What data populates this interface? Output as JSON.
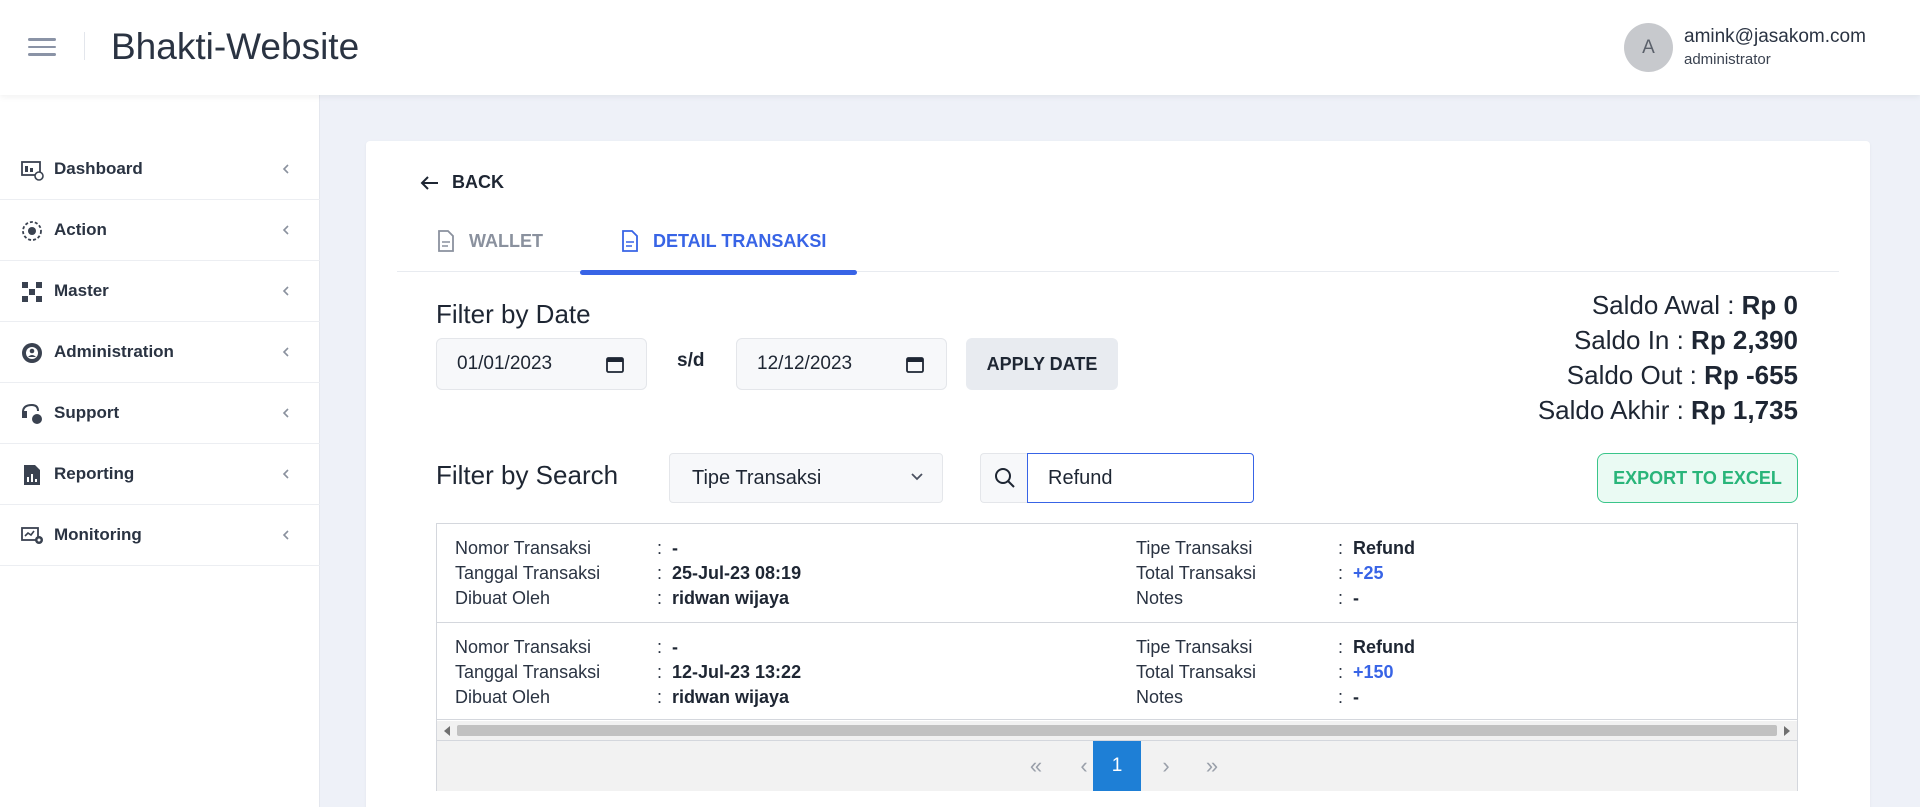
{
  "header": {
    "title": "Bhakti-Website",
    "avatar_initial": "A",
    "user_email": "amink@jasakom.com",
    "user_role": "administrator"
  },
  "sidebar": {
    "items": [
      {
        "label": "Dashboard",
        "icon": "dashboard-icon"
      },
      {
        "label": "Action",
        "icon": "action-icon"
      },
      {
        "label": "Master",
        "icon": "master-icon"
      },
      {
        "label": "Administration",
        "icon": "administration-icon"
      },
      {
        "label": "Support",
        "icon": "support-icon"
      },
      {
        "label": "Reporting",
        "icon": "reporting-icon"
      },
      {
        "label": "Monitoring",
        "icon": "monitoring-icon"
      }
    ]
  },
  "main": {
    "back_label": "BACK",
    "tabs": [
      {
        "label": "WALLET",
        "active": false
      },
      {
        "label": "DETAIL TRANSAKSI",
        "active": true
      }
    ],
    "filter_date": {
      "title": "Filter by Date",
      "from": "01/01/2023",
      "separator": "s/d",
      "to": "12/12/2023",
      "apply_label": "APPLY DATE"
    },
    "saldo": {
      "awal_label": "Saldo Awal : ",
      "awal_value": "Rp 0",
      "in_label": "Saldo In : ",
      "in_value": "Rp 2,390",
      "out_label": "Saldo Out : ",
      "out_value": "Rp -655",
      "akhir_label": "Saldo Akhir : ",
      "akhir_value": "Rp 1,735"
    },
    "filter_search": {
      "title": "Filter by Search",
      "select_value": "Tipe Transaksi",
      "search_value": "Refund",
      "export_label": "EXPORT TO EXCEL"
    },
    "transactions": [
      {
        "nomor_label": "Nomor Transaksi",
        "nomor": "-",
        "tanggal_label": "Tanggal Transaksi",
        "tanggal": "25-Jul-23 08:19",
        "dibuat_label": "Dibuat Oleh",
        "dibuat": "ridwan wijaya",
        "tipe_label": "Tipe Transaksi",
        "tipe": "Refund",
        "total_label": "Total Transaksi",
        "total": "+25",
        "notes_label": "Notes",
        "notes": "-"
      },
      {
        "nomor_label": "Nomor Transaksi",
        "nomor": "-",
        "tanggal_label": "Tanggal Transaksi",
        "tanggal": "12-Jul-23 13:22",
        "dibuat_label": "Dibuat Oleh",
        "dibuat": "ridwan wijaya",
        "tipe_label": "Tipe Transaksi",
        "tipe": "Refund",
        "total_label": "Total Transaksi",
        "total": "+150",
        "notes_label": "Notes",
        "notes": "-"
      }
    ],
    "pagination": {
      "first": "«",
      "prev": "‹",
      "current": "1",
      "next": "›",
      "last": "»"
    },
    "colors": {
      "accent": "#3864e6",
      "export_green": "#29b57a",
      "page_active": "#1e7fd6"
    }
  }
}
